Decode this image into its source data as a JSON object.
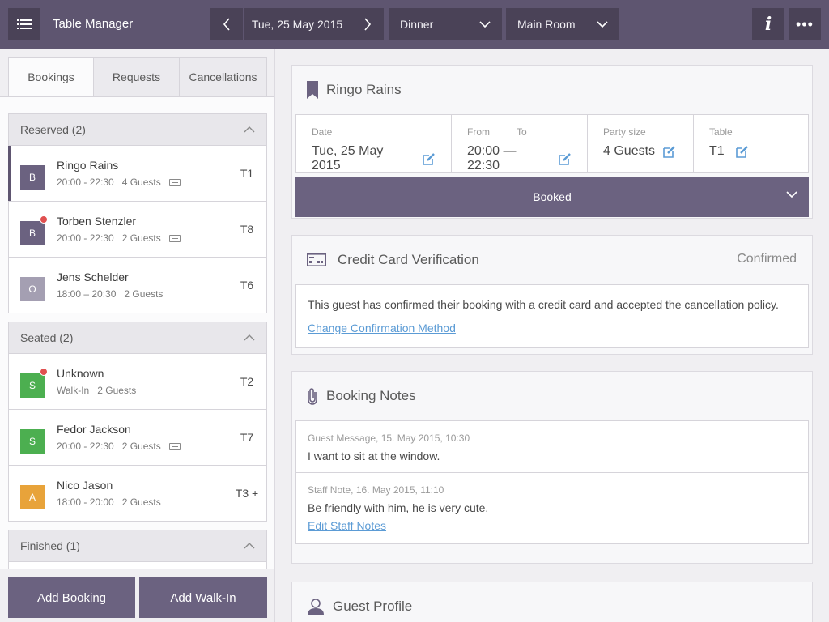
{
  "topbar": {
    "app_title": "Table Manager",
    "date": "Tue, 25 May 2015",
    "shift": "Dinner",
    "room": "Main Room",
    "info_label": "i",
    "more_label": "•••"
  },
  "tabs": [
    {
      "label": "Bookings",
      "active": true
    },
    {
      "label": "Requests",
      "active": false
    },
    {
      "label": "Cancellations",
      "active": false
    }
  ],
  "sections": {
    "reserved": {
      "title": "Reserved (2)",
      "rows": [
        {
          "badge": "B",
          "name": "Ringo Rains",
          "time": "20:00 - 22:30",
          "guests": "4 Guests",
          "table": "T1"
        },
        {
          "badge": "B",
          "name": "Torben Stenzler",
          "time": "20:00 - 22:30",
          "guests": "2 Guests",
          "table": "T8"
        },
        {
          "badge": "O",
          "name": "Jens Schelder",
          "time": "18:00 – 20:30",
          "guests": "2 Guests",
          "table": "T6"
        }
      ]
    },
    "seated": {
      "title": "Seated (2)",
      "rows": [
        {
          "badge": "S",
          "name": "Unknown",
          "time": "Walk-In",
          "guests": "2 Guests",
          "table": "T2"
        },
        {
          "badge": "S",
          "name": "Fedor Jackson",
          "time": "20:00 - 22:30",
          "guests": "2 Guests",
          "table": "T7"
        },
        {
          "badge": "A",
          "name": "Nico Jason",
          "time": "18:00 - 20:00",
          "guests": "2 Guests",
          "table": "T3 +"
        }
      ]
    },
    "finished": {
      "title": "Finished (1)"
    }
  },
  "bottom": {
    "add_booking": "Add Booking",
    "add_walkin": "Add Walk-In"
  },
  "booking": {
    "guest_name": "Ringo Rains",
    "date_label": "Date",
    "date_value": "Tue, 25 May 2015",
    "from_label": "From",
    "to_label": "To",
    "time_value": "20:00 — 22:30",
    "party_label": "Party size",
    "party_value": "4 Guests",
    "table_label": "Table",
    "table_value": "T1",
    "status": "Booked"
  },
  "credit_card": {
    "title": "Credit Card Verification",
    "status": "Confirmed",
    "text": "This guest has confirmed their booking with a credit card and accepted the cancellation policy.",
    "link": "Change Confirmation Method"
  },
  "notes": {
    "title": "Booking Notes",
    "guest_meta": "Guest Message, 15. May 2015, 10:30",
    "guest_text": "I want to sit at the window.",
    "staff_meta": "Staff Note, 16. May 2015, 11:10",
    "staff_text": "Be friendly with him, he is very cute.",
    "link": "Edit Staff Notes"
  },
  "profile": {
    "title": "Guest Profile"
  },
  "colors": {
    "topbar": "#5e5570",
    "accent": "#6b6280",
    "badge_b": "#6b6280",
    "badge_o": "#a49fb2",
    "badge_s": "#4caf50",
    "badge_a": "#e8a33a",
    "alert_dot": "#e05050",
    "link": "#5b9bd5"
  }
}
